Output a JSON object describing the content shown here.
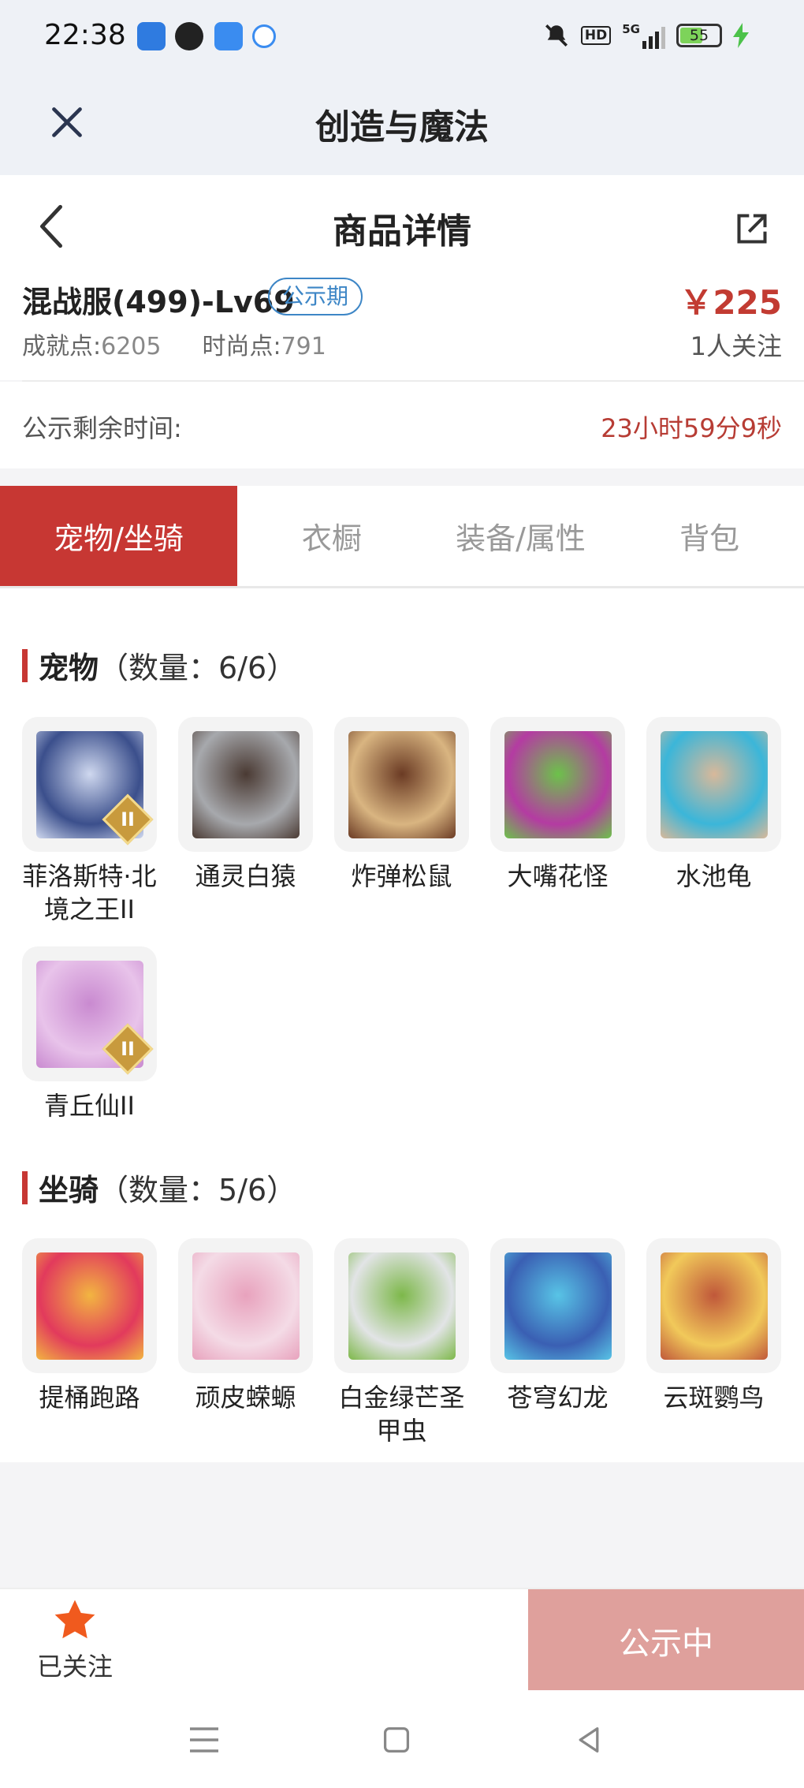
{
  "status_bar": {
    "time": "22:38",
    "hd": "HD",
    "network": "5G",
    "battery": "55"
  },
  "mini_program": {
    "title": "创造与魔法"
  },
  "nav": {
    "title": "商品详情"
  },
  "product": {
    "name": "混战服(499)-Lv69",
    "badge": "公示期",
    "price": "￥225",
    "achievement_label": "成就点:",
    "achievement_value": "6205",
    "fashion_label": "时尚点:",
    "fashion_value": "791",
    "watchers": "1人关注"
  },
  "remaining": {
    "label": "公示剩余时间:",
    "value": "23小时59分9秒"
  },
  "tabs": [
    {
      "label": "宠物/坐骑",
      "active": true
    },
    {
      "label": "衣橱",
      "active": false
    },
    {
      "label": "装备/属性",
      "active": false
    },
    {
      "label": "背包",
      "active": false
    }
  ],
  "pets": {
    "title": "宠物",
    "count": "（数量：6/6）",
    "items": [
      {
        "name": "菲洛斯特·北境之王II",
        "tier": "II",
        "colors": [
          "#3b4f8c",
          "#cfd8ef"
        ]
      },
      {
        "name": "通灵白猿",
        "tier": "",
        "colors": [
          "#a7a9ad",
          "#4a3a33"
        ]
      },
      {
        "name": "炸弹松鼠",
        "tier": "",
        "colors": [
          "#d9b581",
          "#6b3b24"
        ]
      },
      {
        "name": "大嘴花怪",
        "tier": "",
        "colors": [
          "#b43ba2",
          "#6cc24a"
        ]
      },
      {
        "name": "水池龟",
        "tier": "",
        "colors": [
          "#3bb6d9",
          "#d8b89a"
        ]
      },
      {
        "name": "青丘仙II",
        "tier": "II",
        "colors": [
          "#e8c3ea",
          "#c98ad0"
        ]
      }
    ]
  },
  "mounts": {
    "title": "坐骑",
    "count": "（数量：5/6）",
    "items": [
      {
        "name": "提桶跑路",
        "colors": [
          "#e23a5c",
          "#f2b541"
        ]
      },
      {
        "name": "顽皮蝾螈",
        "colors": [
          "#f4dbe6",
          "#e8a2bd"
        ]
      },
      {
        "name": "白金绿芒圣甲虫",
        "colors": [
          "#e2e4e6",
          "#7db84a"
        ]
      },
      {
        "name": "苍穹幻龙",
        "colors": [
          "#3a5fb3",
          "#58c4e6"
        ]
      },
      {
        "name": "云斑鹦鸟",
        "colors": [
          "#f1c95a",
          "#c0583a"
        ]
      }
    ]
  },
  "bottom": {
    "follow_label": "已关注",
    "status_label": "公示中"
  }
}
